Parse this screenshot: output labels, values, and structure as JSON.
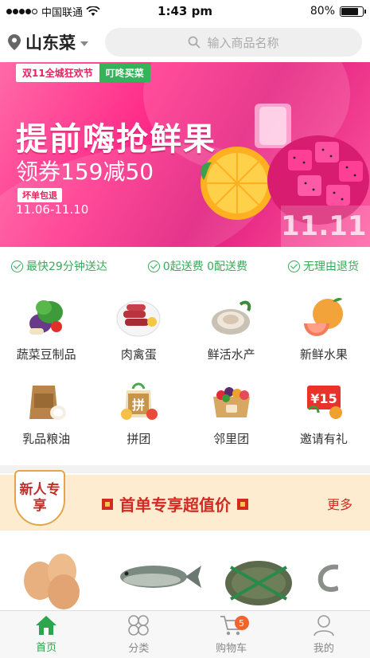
{
  "status_bar": {
    "carrier": "中国联通",
    "time": "1:43 pm",
    "battery": "80%",
    "battery_level": 0.8,
    "signal_strength": 4
  },
  "header": {
    "city": "山东菜",
    "search_placeholder": "输入商品名称"
  },
  "banner": {
    "tag1": "双11全城狂欢节",
    "tag2": "叮咚买菜",
    "title": "提前嗨抢鲜果",
    "subtitle": "领券159减50",
    "badge": "坏单包退",
    "date": "11.06-11.10",
    "watermark": "11.11"
  },
  "promises": [
    {
      "label": "最快29分钟送达"
    },
    {
      "label": "0起送费 0配送费"
    },
    {
      "label": "无理由退货"
    }
  ],
  "categories": [
    {
      "label": "蔬菜豆制品",
      "icon": "vegetables-icon"
    },
    {
      "label": "肉禽蛋",
      "icon": "meat-icon"
    },
    {
      "label": "鲜活水产",
      "icon": "seafood-icon"
    },
    {
      "label": "新鲜水果",
      "icon": "fruit-icon"
    },
    {
      "label": "乳品粮油",
      "icon": "grain-oil-icon"
    },
    {
      "label": "拼团",
      "icon": "group-buy-icon"
    },
    {
      "label": "邻里团",
      "icon": "neighbor-group-icon"
    },
    {
      "label": "邀请有礼",
      "icon": "invite-gift-icon"
    }
  ],
  "group_buy_icon_text": "拼",
  "invite_icon_text": "¥15",
  "new_user": {
    "badge": "新人专享",
    "title": "首单专享超值价",
    "more": "更多"
  },
  "tabbar": [
    {
      "label": "首页",
      "icon": "home-icon",
      "active": true
    },
    {
      "label": "分类",
      "icon": "category-icon",
      "active": false
    },
    {
      "label": "购物车",
      "icon": "cart-icon",
      "active": false,
      "badge": "5"
    },
    {
      "label": "我的",
      "icon": "profile-icon",
      "active": false
    }
  ],
  "colors": {
    "accent_green": "#2da44e",
    "banner_pink": "#ff2f8a",
    "promo_red": "#d22a23",
    "badge_orange": "#f2642a"
  }
}
